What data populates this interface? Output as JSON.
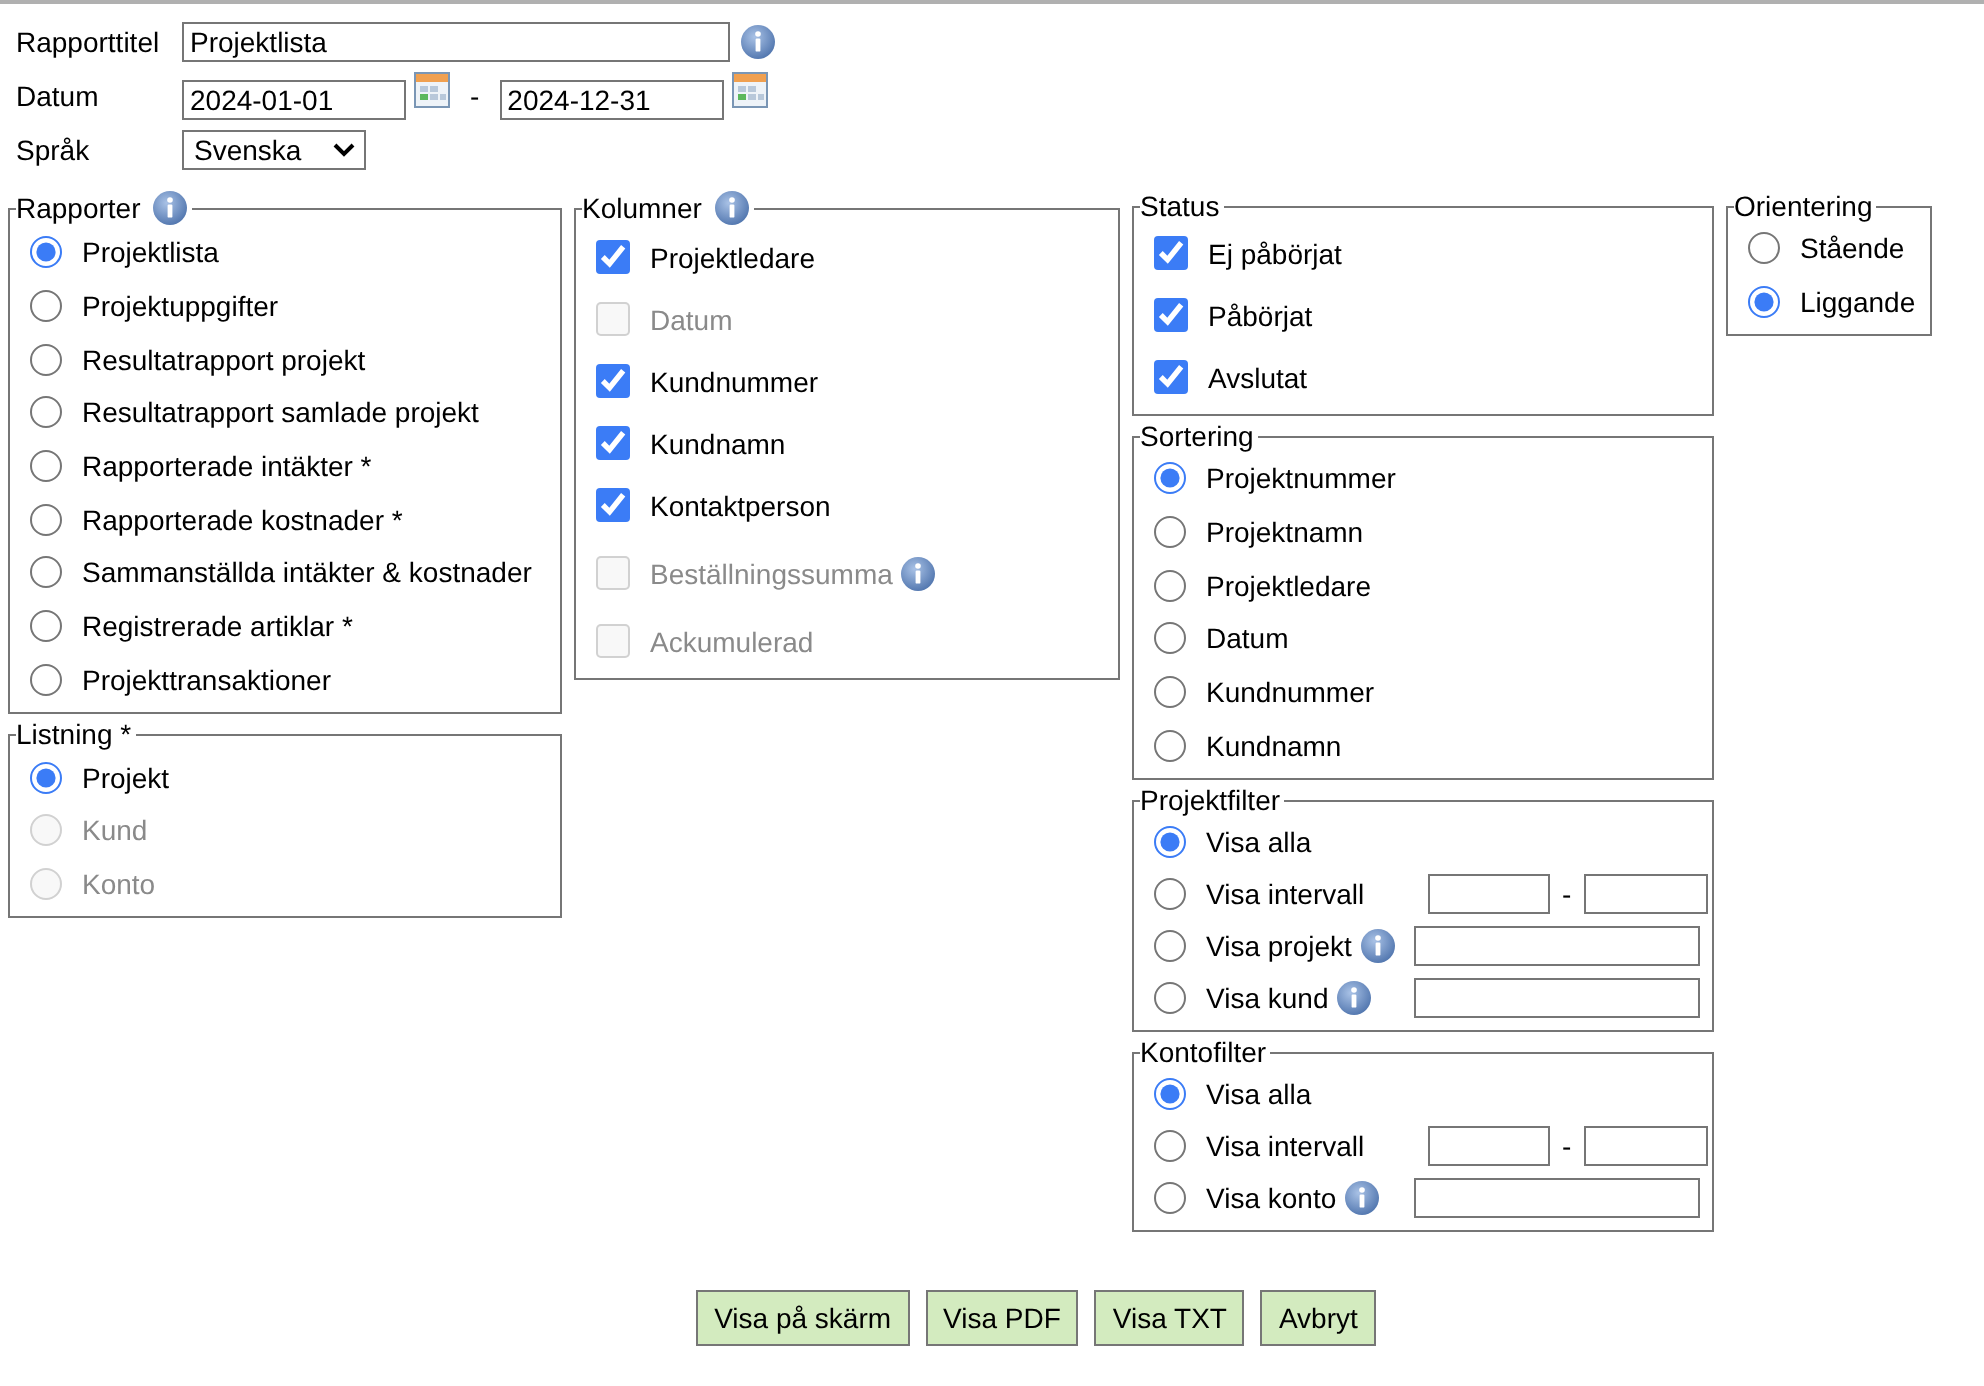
{
  "header": {
    "title_label": "Rapporttitel",
    "title_value": "Projektlista",
    "date_label": "Datum",
    "date_from": "2024-01-01",
    "date_separator": "-",
    "date_to": "2024-12-31",
    "language_label": "Språk",
    "language_value": "Svenska"
  },
  "columns": [
    [
      {
        "legend": "Rapporter",
        "legend_info": true,
        "kind": "radio",
        "items": [
          {
            "label": "Projektlista",
            "selected": true,
            "disabled": false
          },
          {
            "label": "Projektuppgifter",
            "selected": false,
            "disabled": false
          },
          {
            "label": "Resultatrapport projekt",
            "selected": false,
            "disabled": false
          },
          {
            "label": "Resultatrapport samlade projekt",
            "selected": false,
            "disabled": false
          },
          {
            "label": "Rapporterade intäkter *",
            "selected": false,
            "disabled": false
          },
          {
            "label": "Rapporterade kostnader *",
            "selected": false,
            "disabled": false
          },
          {
            "label": "Sammanställda intäkter & kostnader",
            "selected": false,
            "disabled": false
          },
          {
            "label": "Registrerade artiklar *",
            "selected": false,
            "disabled": false
          },
          {
            "label": "Projekttransaktioner",
            "selected": false,
            "disabled": false
          }
        ]
      },
      {
        "legend": "Listning *",
        "legend_info": false,
        "kind": "radio",
        "items": [
          {
            "label": "Projekt",
            "selected": true,
            "disabled": false
          },
          {
            "label": "Kund",
            "selected": false,
            "disabled": true
          },
          {
            "label": "Konto",
            "selected": false,
            "disabled": true
          }
        ]
      }
    ],
    [
      {
        "legend": "Kolumner",
        "legend_info": true,
        "kind": "checkbox",
        "items": [
          {
            "label": "Projektledare",
            "checked": true,
            "disabled": false,
            "info": false
          },
          {
            "label": "Datum",
            "checked": false,
            "disabled": true,
            "info": false
          },
          {
            "label": "Kundnummer",
            "checked": true,
            "disabled": false,
            "info": false
          },
          {
            "label": "Kundnamn",
            "checked": true,
            "disabled": false,
            "info": false
          },
          {
            "label": "Kontaktperson",
            "checked": true,
            "disabled": false,
            "info": false
          },
          {
            "label": "Beställningssumma",
            "checked": false,
            "disabled": true,
            "info": true
          },
          {
            "label": "Ackumulerad",
            "checked": false,
            "disabled": true,
            "info": false
          }
        ]
      }
    ],
    [
      {
        "legend": "Status",
        "legend_info": false,
        "kind": "checkbox",
        "items": [
          {
            "label": "Ej påbörjat",
            "checked": true,
            "disabled": false,
            "info": false
          },
          {
            "label": "Påbörjat",
            "checked": true,
            "disabled": false,
            "info": false
          },
          {
            "label": "Avslutat",
            "checked": true,
            "disabled": false,
            "info": false
          }
        ]
      },
      {
        "legend": "Sortering",
        "legend_info": false,
        "kind": "radio",
        "items": [
          {
            "label": "Projektnummer",
            "selected": true,
            "disabled": false
          },
          {
            "label": "Projektnamn",
            "selected": false,
            "disabled": false
          },
          {
            "label": "Projektledare",
            "selected": false,
            "disabled": false
          },
          {
            "label": "Datum",
            "selected": false,
            "disabled": false
          },
          {
            "label": "Kundnummer",
            "selected": false,
            "disabled": false
          },
          {
            "label": "Kundnamn",
            "selected": false,
            "disabled": false
          }
        ]
      },
      {
        "legend": "Projektfilter",
        "legend_info": false,
        "kind": "filter",
        "items": [
          {
            "label": "Visa alla",
            "selected": true,
            "kind": "plain",
            "info": false
          },
          {
            "label": "Visa intervall",
            "selected": false,
            "kind": "range",
            "separator": "-",
            "info": false
          },
          {
            "label": "Visa projekt",
            "selected": false,
            "kind": "text",
            "info": true
          },
          {
            "label": "Visa kund",
            "selected": false,
            "kind": "text",
            "info": true
          }
        ]
      },
      {
        "legend": "Kontofilter",
        "legend_info": false,
        "kind": "filter",
        "items": [
          {
            "label": "Visa alla",
            "selected": true,
            "kind": "plain",
            "info": false
          },
          {
            "label": "Visa intervall",
            "selected": false,
            "kind": "range",
            "separator": "-",
            "info": false
          },
          {
            "label": "Visa konto",
            "selected": false,
            "kind": "text",
            "info": true
          }
        ]
      }
    ],
    [
      {
        "legend": "Orientering",
        "legend_info": false,
        "kind": "radio",
        "items": [
          {
            "label": "Stående",
            "selected": false,
            "disabled": false
          },
          {
            "label": "Liggande",
            "selected": true,
            "disabled": false
          }
        ]
      }
    ]
  ],
  "buttons": [
    "Visa på skärm",
    "Visa PDF",
    "Visa TXT",
    "Avbryt"
  ]
}
